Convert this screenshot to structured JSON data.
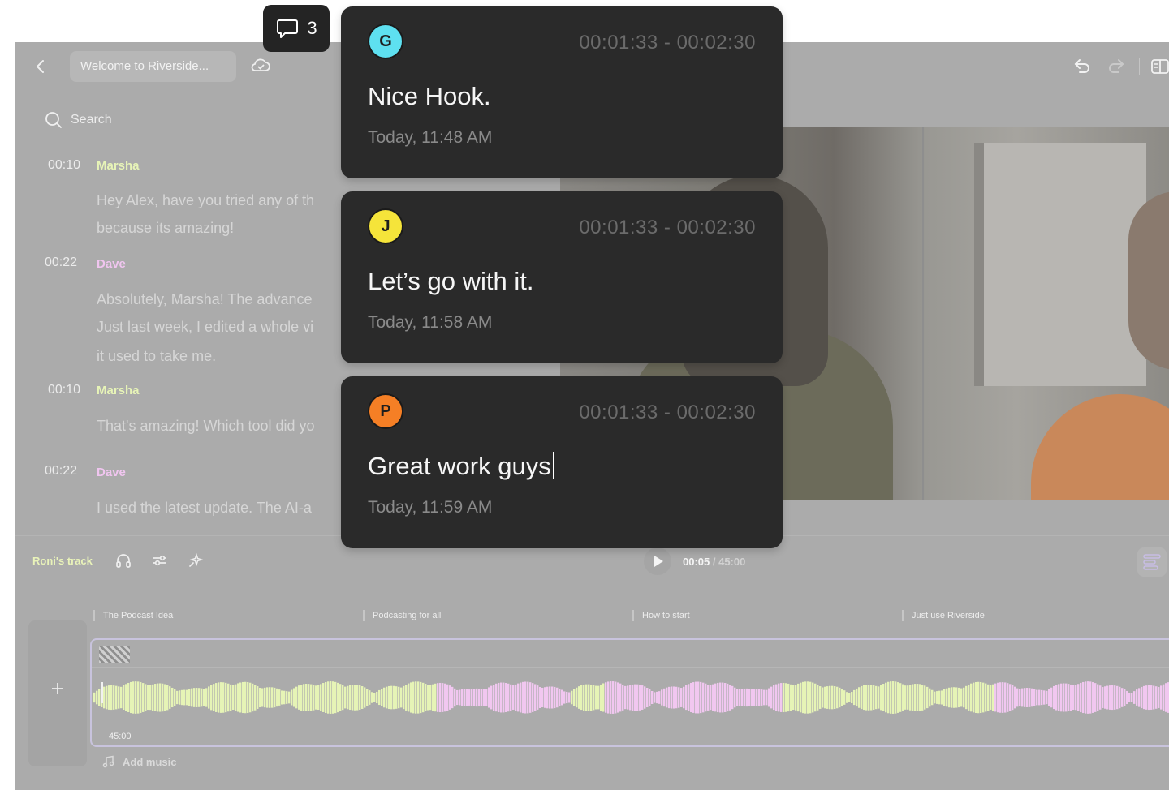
{
  "header": {
    "project_title": "Welcome to Riverside...",
    "comment_count": "3"
  },
  "search": {
    "placeholder": "Search"
  },
  "transcript": [
    {
      "time": "00:10",
      "speaker": "Marsha",
      "speaker_color": "#e7f4b7",
      "lines": [
        "Hey Alex, have you tried any of th",
        "because its amazing!"
      ]
    },
    {
      "time": "00:22",
      "speaker": "Dave",
      "speaker_color": "#f0c5ef",
      "lines": [
        "Absolutely, Marsha! The advance",
        "Just last week, I edited a whole vi",
        "it used to take me."
      ]
    },
    {
      "time": "00:10",
      "speaker": "Marsha",
      "speaker_color": "#e7f4b7",
      "lines": [
        "That's amazing! Which tool did yo"
      ]
    },
    {
      "time": "00:22",
      "speaker": "Dave",
      "speaker_color": "#f0c5ef",
      "lines": [
        " I used the latest update. The AI-a"
      ]
    }
  ],
  "timeline": {
    "track_label": "Roni's track",
    "current_time": "00:05",
    "total_time": "/ 45:00",
    "chapters": [
      "The Podcast Idea",
      "Podcasting for all",
      "How to start",
      "Just use Riverside"
    ],
    "track_duration": "45:00",
    "add_music_label": "Add music",
    "wave_colors": {
      "speaker_a": "#e6f4b6",
      "speaker_b": "#f1c7f0"
    }
  },
  "comments": [
    {
      "initial": "G",
      "avatar_color": "#5ee0f0",
      "range": "00:01:33 - 00:02:30",
      "text": "Nice Hook.",
      "timestamp": "Today, 11:48 AM"
    },
    {
      "initial": "J",
      "avatar_color": "#f5e43a",
      "range": "00:01:33 - 00:02:30",
      "text": "Let’s go with it.",
      "timestamp": "Today, 11:58 AM"
    },
    {
      "initial": "P",
      "avatar_color": "#f57f25",
      "range": "00:01:33 - 00:02:30",
      "text": "Great work guys",
      "timestamp": "Today, 11:59 AM"
    }
  ]
}
